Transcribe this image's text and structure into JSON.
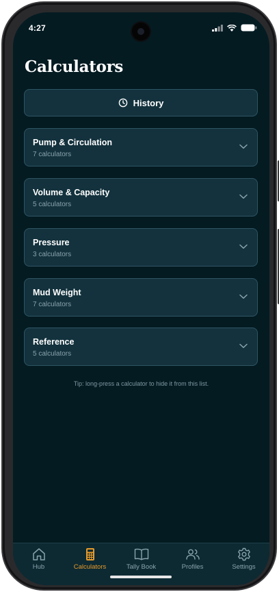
{
  "status_bar": {
    "time": "4:27"
  },
  "page": {
    "title": "Calculators"
  },
  "history_button": {
    "label": "History"
  },
  "categories": [
    {
      "title": "Pump & Circulation",
      "subtitle": "7 calculators"
    },
    {
      "title": "Volume & Capacity",
      "subtitle": "5 calculators"
    },
    {
      "title": "Pressure",
      "subtitle": "3 calculators"
    },
    {
      "title": "Mud Weight",
      "subtitle": "7 calculators"
    },
    {
      "title": "Reference",
      "subtitle": "5 calculators"
    }
  ],
  "tip": "Tip: long-press a calculator to hide it from this list.",
  "tabs": [
    {
      "label": "Hub",
      "icon": "home-icon",
      "active": false
    },
    {
      "label": "Calculators",
      "icon": "calculator-icon",
      "active": true
    },
    {
      "label": "Tally Book",
      "icon": "book-icon",
      "active": false
    },
    {
      "label": "Profiles",
      "icon": "users-icon",
      "active": false
    },
    {
      "label": "Settings",
      "icon": "gear-icon",
      "active": false
    }
  ],
  "colors": {
    "background": "#041b22",
    "card": "#13323d",
    "card_border": "#2f5564",
    "accent": "#e59a2c",
    "muted_text": "#8aa3ac"
  }
}
